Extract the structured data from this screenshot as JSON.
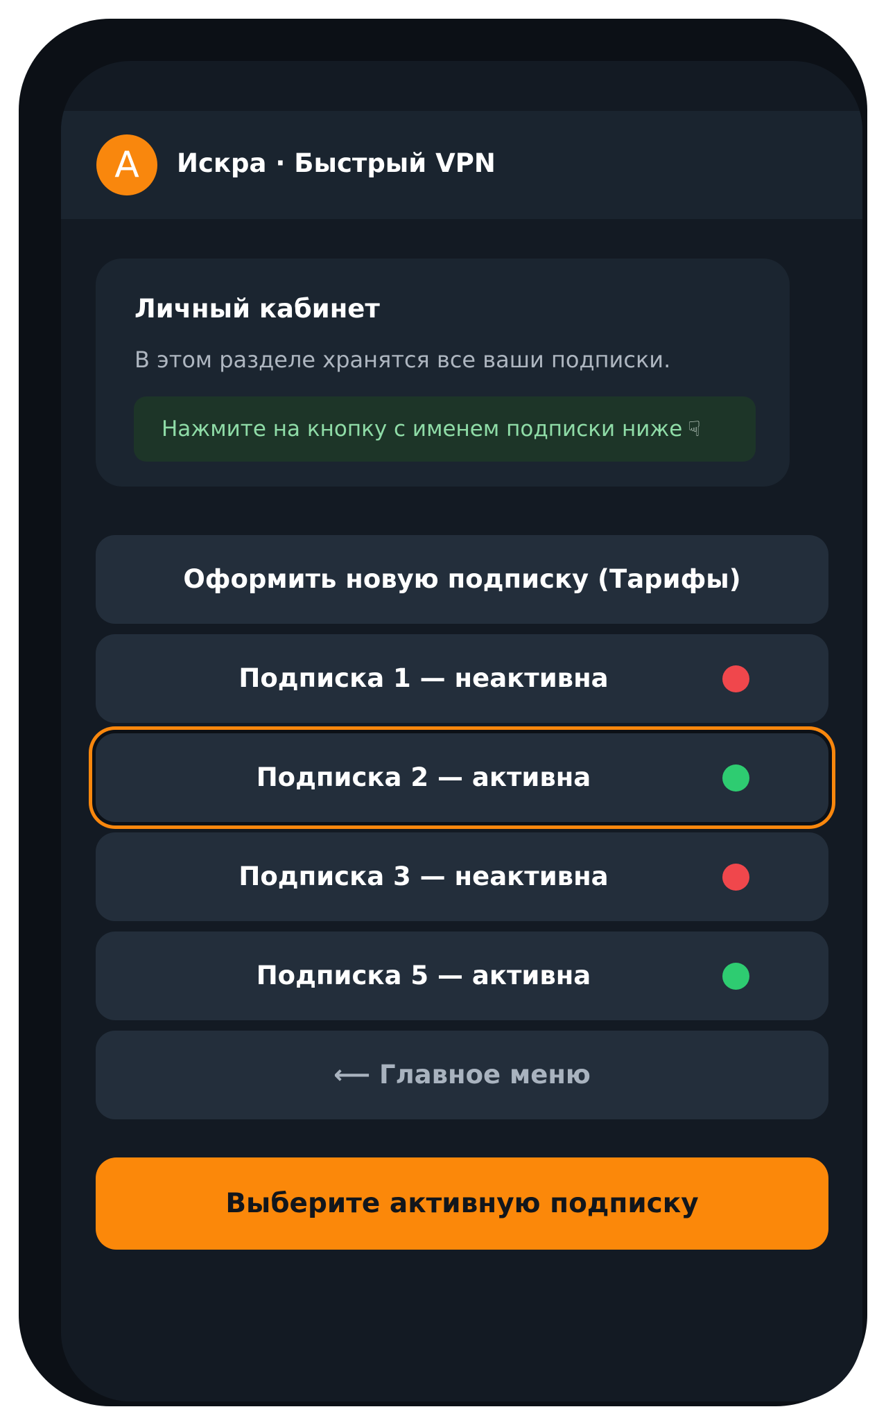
{
  "app": {
    "avatar_letter": "A",
    "title": "Искра · Быстрый VPN"
  },
  "info_card": {
    "title": "Личный кабинет",
    "description": "В этом разделе хранятся все ваши подписки.",
    "hint": "Нажмите на кнопку с именем подписки ниже",
    "hint_icon": "pointing-hand-icon",
    "hint_glyph": "☟"
  },
  "buttons": {
    "new_subscription": "Оформить новую подписку (Тарифы)",
    "back": "⟵ Главное меню"
  },
  "subscriptions": [
    {
      "label": "Подписка 1 — неактивна",
      "status": "inactive",
      "color": "#f0474c"
    },
    {
      "label": "Подписка 2 — активна",
      "status": "active",
      "color": "#2ecc71",
      "selected": true
    },
    {
      "label": "Подписка 3 — неактивна",
      "status": "inactive",
      "color": "#f0474c"
    },
    {
      "label": "Подписка 5 — активна",
      "status": "active",
      "color": "#2ecc71"
    }
  ],
  "cta": {
    "label": "Выберите активную подписку"
  },
  "colors": {
    "accent": "#fb880a",
    "active": "#2ecc71",
    "inactive": "#f0474c",
    "background": "#131a23"
  }
}
